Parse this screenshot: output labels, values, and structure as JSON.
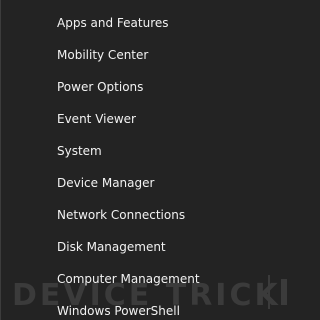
{
  "menu": {
    "items": [
      {
        "label": "Apps and Features"
      },
      {
        "label": "Mobility Center"
      },
      {
        "label": "Power Options"
      },
      {
        "label": "Event Viewer"
      },
      {
        "label": "System"
      },
      {
        "label": "Device Manager"
      },
      {
        "label": "Network Connections"
      },
      {
        "label": "Disk Management"
      },
      {
        "label": "Computer Management"
      },
      {
        "label": "Windows PowerShell"
      }
    ]
  },
  "watermark": {
    "text": "DEVICE TRICKS"
  },
  "colors": {
    "background": "#232323",
    "text": "#f2f2f2",
    "watermark": "#3b3b3b"
  }
}
